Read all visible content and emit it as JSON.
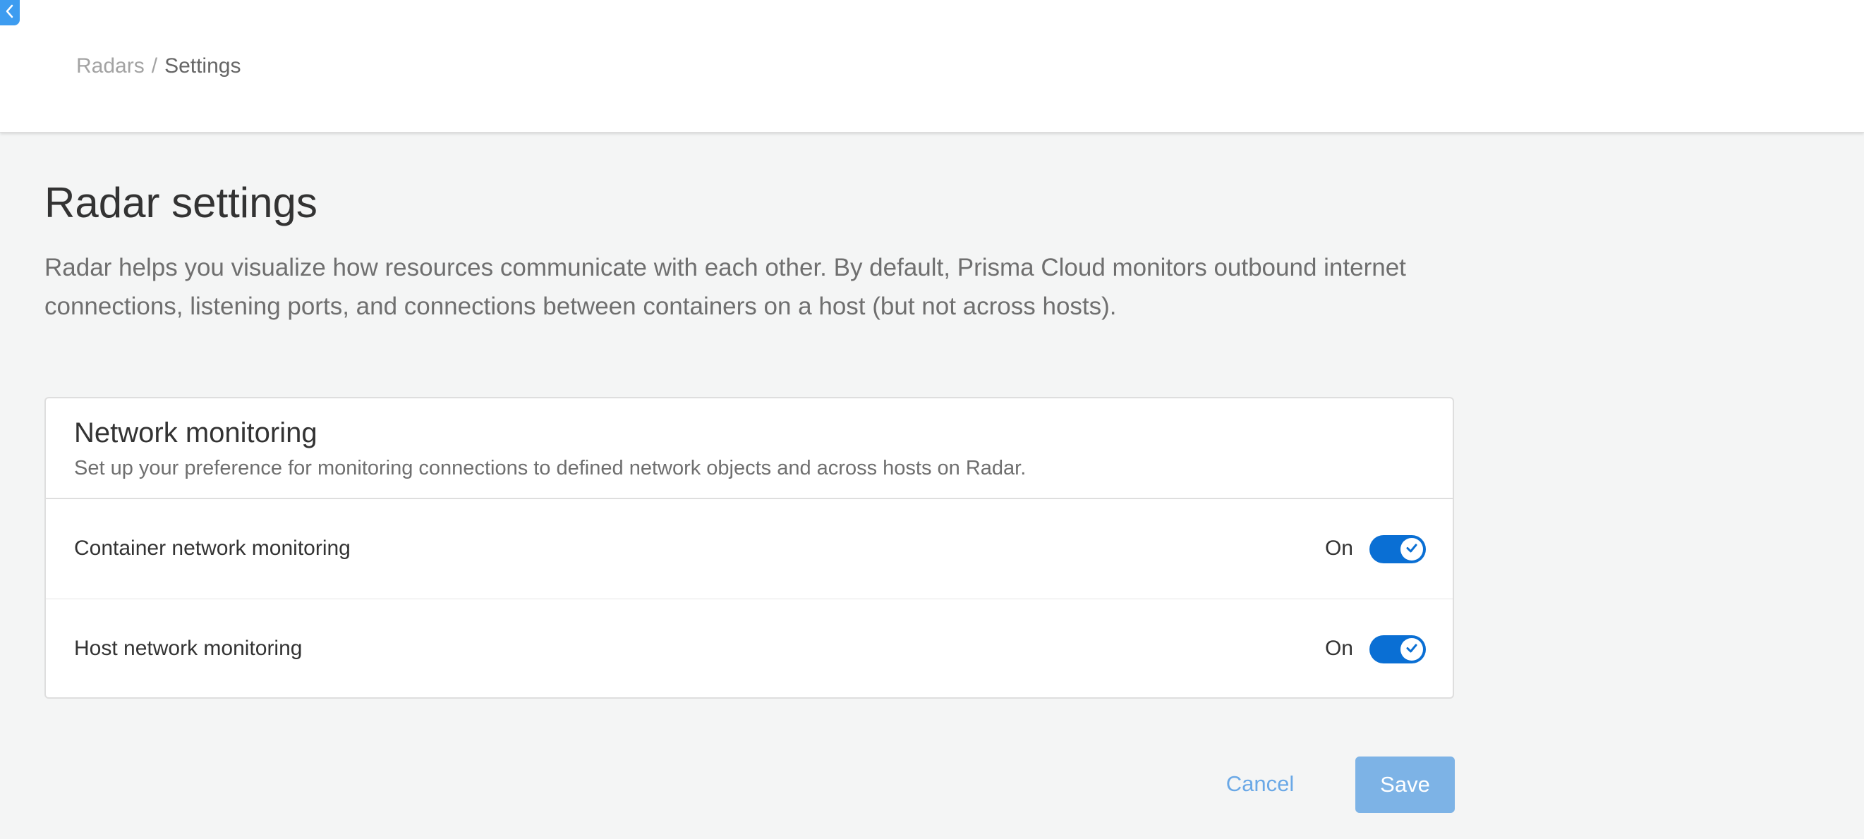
{
  "header": {
    "back_icon": "chevron-left-icon",
    "breadcrumb": {
      "parent": "Radars",
      "separator": "/",
      "current": "Settings"
    }
  },
  "main": {
    "title": "Radar settings",
    "description": "Radar helps you visualize how resources communicate with each other. By default, Prisma Cloud monitors outbound internet connections, listening ports, and connections between containers on a host (but not across hosts)."
  },
  "network_monitoring": {
    "title": "Network monitoring",
    "subtitle": "Set up your preference for monitoring connections to defined network objects and across hosts on Radar.",
    "settings": [
      {
        "label": "Container network monitoring",
        "state": "On",
        "enabled": true,
        "icon": "check-icon"
      },
      {
        "label": "Host network monitoring",
        "state": "On",
        "enabled": true,
        "icon": "check-icon"
      }
    ]
  },
  "actions": {
    "cancel_label": "Cancel",
    "save_label": "Save"
  },
  "colors": {
    "accent": "#0a6fd4",
    "back_tab": "#3d9cf0",
    "save_button_disabled": "#7db3e6",
    "cancel_link": "#6aa8e6",
    "page_background": "#f4f5f5"
  }
}
